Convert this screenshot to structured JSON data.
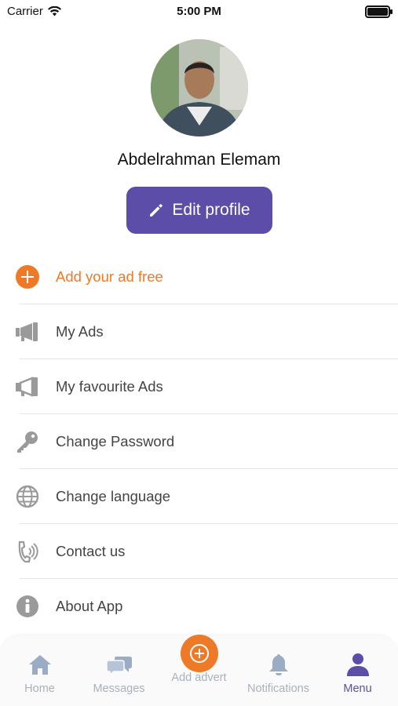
{
  "status_bar": {
    "carrier": "Carrier",
    "time": "5:00 PM"
  },
  "profile": {
    "name": "Abdelrahman Elemam",
    "edit_label": "Edit profile"
  },
  "colors": {
    "brand": "#5c4ea8",
    "accent": "#ee7a27",
    "icon_gray": "#9a9a9a",
    "tab_inactive": "#a8b1bd"
  },
  "menu": {
    "items": [
      {
        "label": "Add your ad free",
        "icon": "add-circle-icon"
      },
      {
        "label": "My Ads",
        "icon": "megaphone-icon"
      },
      {
        "label": "My favourite Ads",
        "icon": "megaphone-outline-icon"
      },
      {
        "label": "Change Password",
        "icon": "key-icon"
      },
      {
        "label": "Change language",
        "icon": "globe-icon"
      },
      {
        "label": "Contact us",
        "icon": "phone-icon"
      },
      {
        "label": "About App",
        "icon": "info-icon"
      }
    ]
  },
  "tabbar": {
    "tabs": [
      {
        "label": "Home",
        "icon": "home-icon"
      },
      {
        "label": "Messages",
        "icon": "chat-icon"
      },
      {
        "label": "Add advert",
        "icon": "plus-icon"
      },
      {
        "label": "Notifications",
        "icon": "bell-icon"
      },
      {
        "label": "Menu",
        "icon": "user-icon"
      }
    ],
    "active": "Menu"
  }
}
